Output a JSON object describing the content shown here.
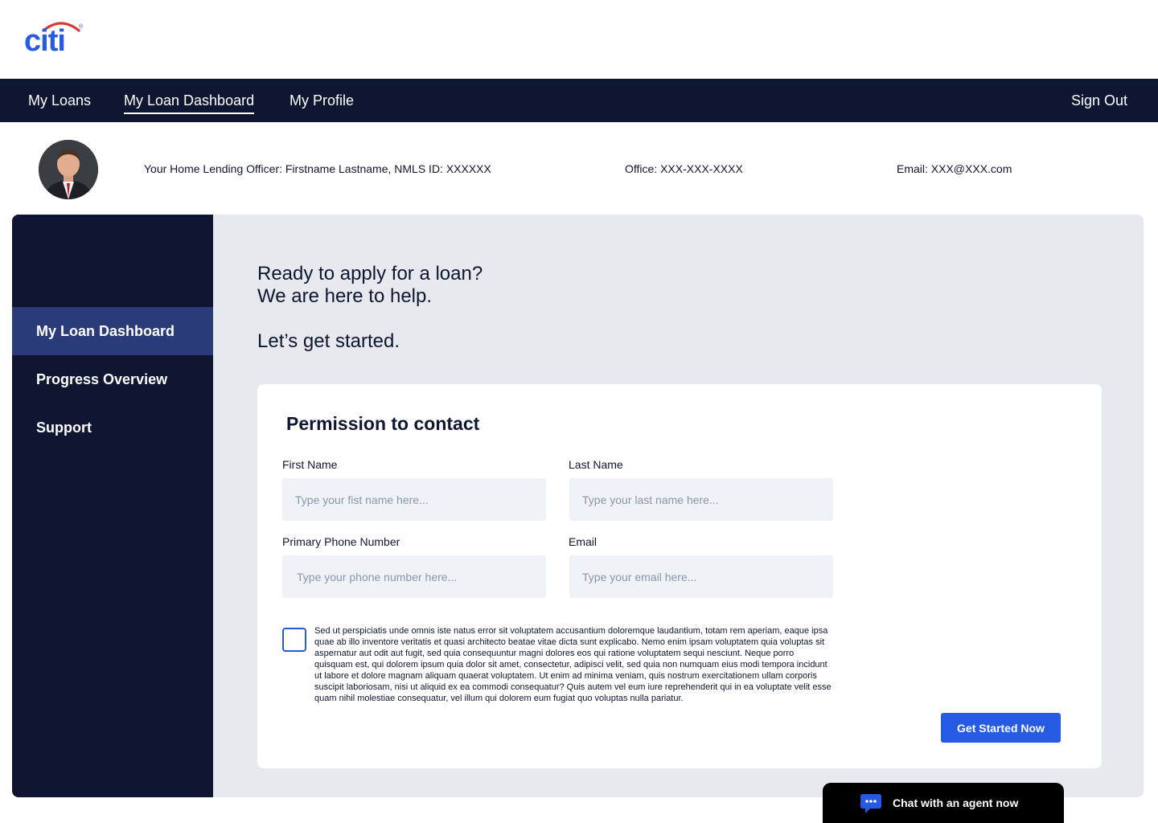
{
  "brand": {
    "name": "citi",
    "color": "#255be3",
    "accent": "#e0342c"
  },
  "topnav": {
    "items": [
      {
        "label": "My Loans",
        "active": false
      },
      {
        "label": "My Loan Dashboard",
        "active": true
      },
      {
        "label": "My Profile",
        "active": false
      }
    ],
    "sign_out": "Sign Out"
  },
  "officer": {
    "lending_officer": "Your Home Lending Officer: Firstname Lastname, NMLS ID: XXXXXX",
    "office": "Office: XXX-XXX-XXXX",
    "email": "Email: XXX@XXX.com"
  },
  "sidebar": {
    "items": [
      {
        "label": "My Loan Dashboard",
        "active": true
      },
      {
        "label": "Progress Overview",
        "active": false
      },
      {
        "label": "Support",
        "active": false
      }
    ]
  },
  "hero": {
    "line1": "Ready to apply for a loan?",
    "line2": "We are here to help.",
    "line3": "Let’s get started."
  },
  "form": {
    "title": "Permission to contact",
    "first_name": {
      "label": "First Name",
      "placeholder": "Type your fist name here...",
      "value": ""
    },
    "last_name": {
      "label": "Last Name",
      "placeholder": "Type your last name here...",
      "value": ""
    },
    "phone": {
      "label": "Primary Phone Number",
      "placeholder": "Type your phone number here...",
      "value": ""
    },
    "email": {
      "label": "Email",
      "placeholder": "Type your email here...",
      "value": ""
    },
    "consent_checked": false,
    "consent_text": "Sed ut perspiciatis unde omnis iste natus error sit voluptatem accusantium doloremque laudantium, totam rem aperiam, eaque ipsa quae ab illo inventore veritatis et quasi architecto beatae vitae dicta sunt explicabo. Nemo enim ipsam voluptatem quia voluptas sit aspernatur aut odit aut fugit, sed quia consequuntur magni dolores eos qui ratione voluptatem sequi nesciunt. Neque porro quisquam est, qui dolorem ipsum quia dolor sit amet, consectetur, adipisci velit, sed quia non numquam eius modi tempora incidunt ut labore et dolore magnam aliquam quaerat voluptatem. Ut enim ad minima veniam, quis nostrum exercitationem ullam corporis suscipit laboriosam, nisi ut aliquid ex ea commodi consequatur? Quis autem vel eum iure reprehenderit qui in ea voluptate velit esse quam nihil molestiae consequatur, vel illum qui dolorem eum fugiat quo voluptas nulla pariatur.",
    "submit_label": "Get Started Now"
  },
  "chat": {
    "label": "Chat with an agent now",
    "icon": "chat-bubble-icon"
  },
  "colors": {
    "navy": "#0f1632",
    "sidebar_active": "#2a3b7a",
    "primary": "#255be3",
    "panel_bg": "#e6eaee",
    "input_bg": "#eff2f6"
  }
}
